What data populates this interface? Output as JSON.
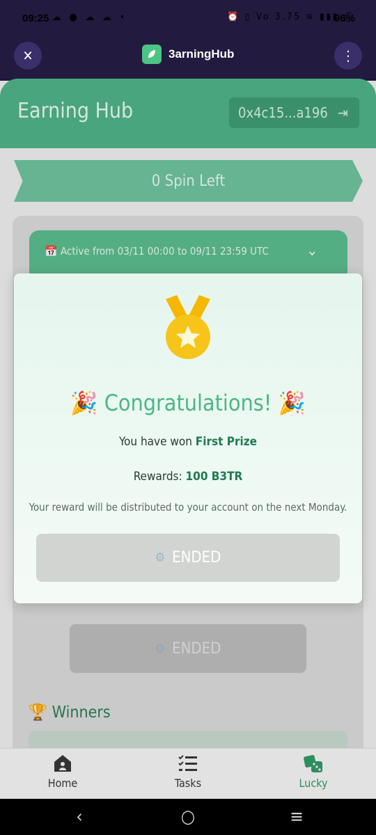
{
  "status_bar": {
    "time": "09:25",
    "left_icons": "☁ ● ☁ ☁ •",
    "right_icons": "⏰ ▯ Vo 3.75 ≋ ▮▮▮ ◯",
    "battery": "96%"
  },
  "header": {
    "close_icon": "✕",
    "app_name": "3arningHub",
    "more_icon": "⋮"
  },
  "page": {
    "title": "Earning Hub",
    "wallet": "0x4c15...a196",
    "logout_icon": "⇥"
  },
  "spin": {
    "label": "0 Spin Left"
  },
  "event": {
    "active_text": "📅 Active from 03/11 00:00 to 09/11 23:59 UTC",
    "chevron": "⌄"
  },
  "background_button": {
    "label": "ENDED",
    "icon": "⚙"
  },
  "winners": {
    "icon": "🏆",
    "title": "Winners"
  },
  "modal": {
    "title": "Congratulations!",
    "left_emoji": "🎉",
    "right_emoji": "🎉",
    "won_prefix": "You have won ",
    "prize": "First Prize",
    "rewards_prefix": "Rewards: ",
    "rewards_value": "100 B3TR",
    "note": "Your reward will be distributed to your account on the next Monday.",
    "button_label": "ENDED",
    "button_icon": "⚙"
  },
  "bottom_nav": {
    "items": [
      {
        "label": "Home",
        "active": false
      },
      {
        "label": "Tasks",
        "active": false
      },
      {
        "label": "Lucky",
        "active": true
      }
    ]
  },
  "android_nav": {
    "back": "‹",
    "home": "○",
    "recents": "≡"
  },
  "colors": {
    "accent": "#4fb487",
    "header_bg": "#221a3f",
    "active_nav": "#2d8e5d"
  }
}
